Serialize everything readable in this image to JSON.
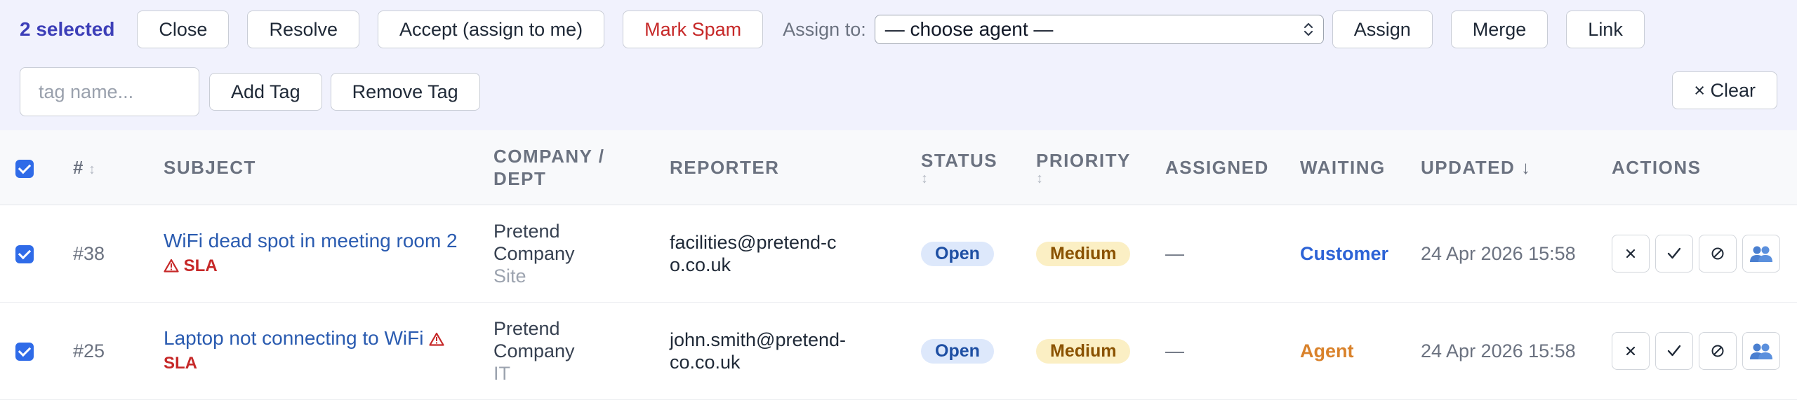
{
  "bulk": {
    "selected_text": "2 selected",
    "buttons": {
      "close": "Close",
      "resolve": "Resolve",
      "accept": "Accept (assign to me)",
      "spam": "Mark Spam",
      "assign": "Assign",
      "merge": "Merge",
      "link": "Link",
      "add_tag": "Add Tag",
      "remove_tag": "Remove Tag",
      "clear": "× Clear"
    },
    "assign_label": "Assign to:",
    "agent_select_value": "— choose agent —",
    "tag_placeholder": "tag name..."
  },
  "table": {
    "headers": {
      "num": "#",
      "subject": "SUBJECT",
      "company": "COMPANY / DEPT",
      "reporter": "REPORTER",
      "status": "STATUS",
      "priority": "PRIORITY",
      "assigned": "ASSIGNED",
      "waiting": "WAITING",
      "updated": "UPDATED ↓",
      "actions": "ACTIONS"
    },
    "rows": [
      {
        "id": "#38",
        "subject": "WiFi dead spot in meeting room 2",
        "sla": "SLA",
        "company": "Pretend Company",
        "dept": "Site",
        "reporter": "facilities@pretend-co.co.uk",
        "status": "Open",
        "priority": "Medium",
        "assigned": "—",
        "waiting": "Customer",
        "updated": "24 Apr 2026 15:58"
      },
      {
        "id": "#25",
        "subject": "Laptop not connecting to WiFi",
        "sla": "SLA",
        "company": "Pretend Company",
        "dept": "IT",
        "reporter": "john.smith@pretend-co.co.uk",
        "status": "Open",
        "priority": "Medium",
        "assigned": "—",
        "waiting": "Agent",
        "updated": "24 Apr 2026 15:58"
      }
    ]
  },
  "icons": {
    "close": "x-icon",
    "resolve": "check-icon",
    "spam": "ban-icon",
    "assign": "users-icon",
    "sla": "warning-icon",
    "sort": "sort-icon"
  },
  "colors": {
    "accent": "#3d3fb8",
    "link": "#2a5bb0",
    "danger": "#c62828",
    "checkbox": "#2f6be8"
  }
}
